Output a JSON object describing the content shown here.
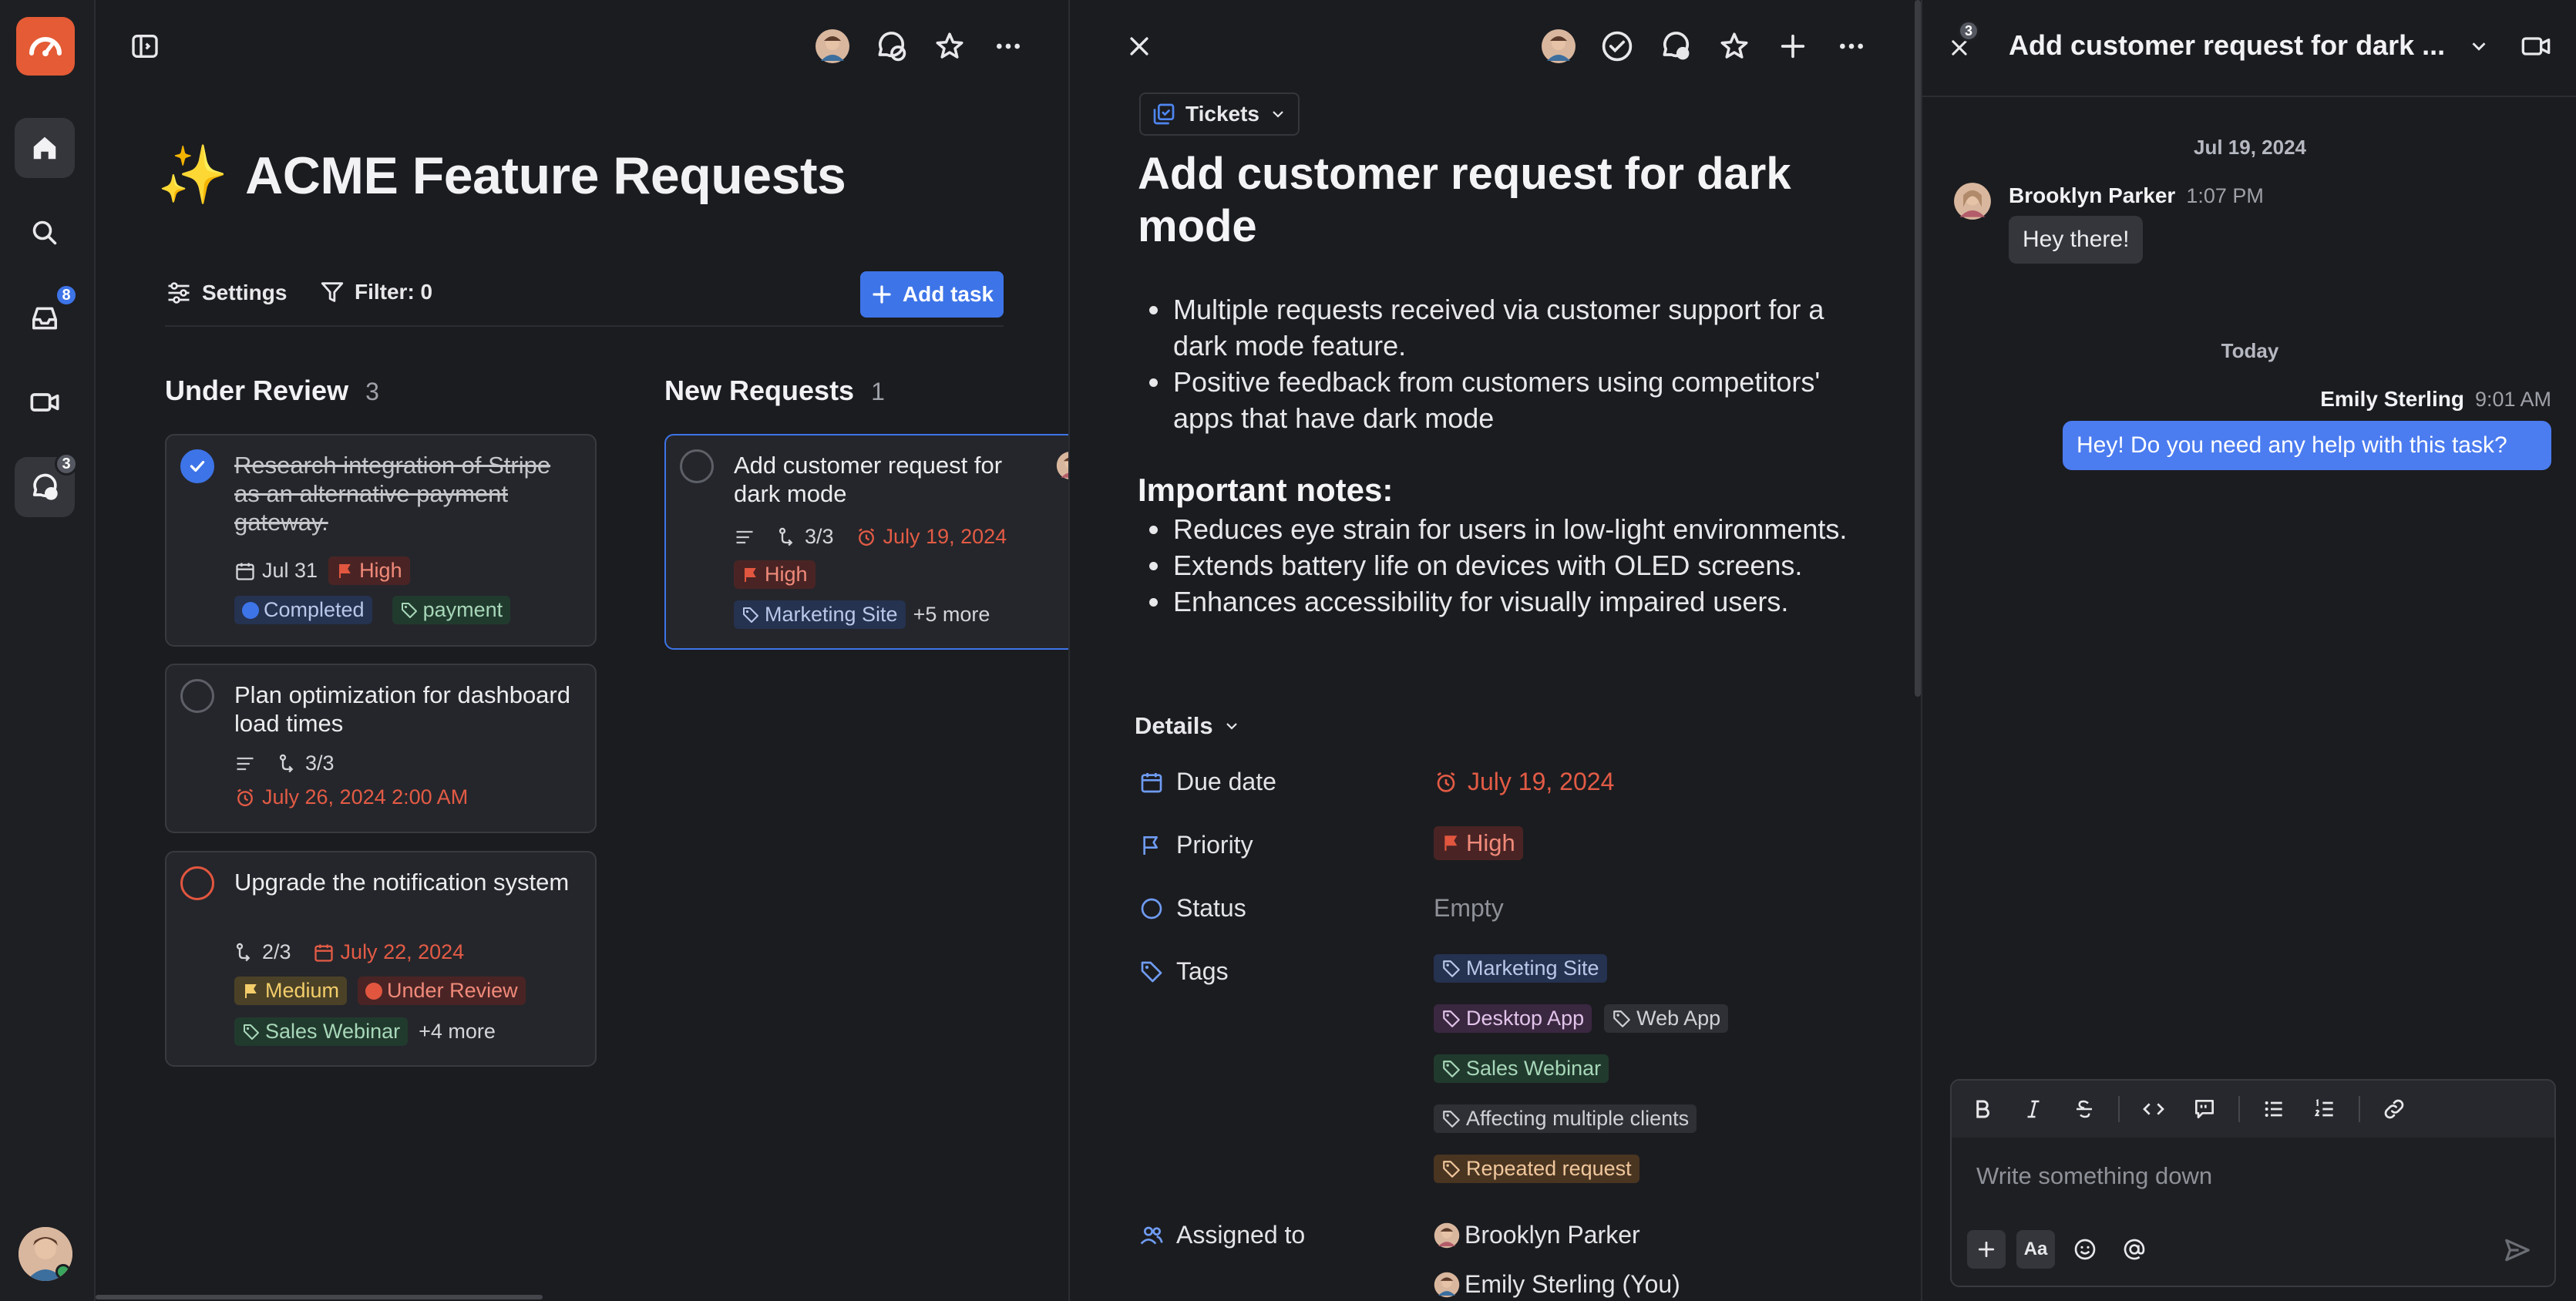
{
  "colors": {
    "accent": "#3d74e8",
    "danger": "#e35b45",
    "logo": "#e45b35"
  },
  "rail": {
    "inbox_badge": "8",
    "chat_badge": "3"
  },
  "board": {
    "title_emoji": "✨",
    "title": "ACME Feature Requests",
    "settings_label": "Settings",
    "filter_label": "Filter: 0",
    "add_task_label": "Add task",
    "columns": [
      {
        "title": "Under Review",
        "count": "3",
        "cards": [
          {
            "title": "Research integration of Stripe as an alternative payment gateway.",
            "date": "Jul 31",
            "priority": "High",
            "status": "Completed",
            "tag": "payment"
          },
          {
            "title": "Plan optimization for dashboard load times",
            "subtasks": "3/3",
            "due": "July 26, 2024 2:00 AM"
          },
          {
            "title": "Upgrade the notification system",
            "subtasks": "2/3",
            "due": "July 22, 2024",
            "priority": "Medium",
            "status": "Under Review",
            "tag": "Sales Webinar",
            "more": "+4 more"
          }
        ]
      },
      {
        "title": "New Requests",
        "count": "1",
        "cards": [
          {
            "title": "Add customer request for dark mode",
            "subtasks": "3/3",
            "due": "July 19, 2024",
            "priority": "High",
            "tag": "Marketing Site",
            "more": "+5 more"
          }
        ]
      }
    ]
  },
  "detail": {
    "breadcrumb": "Tickets",
    "title": "Add customer request for dark mode",
    "bullets": [
      "Multiple requests received via customer support for a dark mode feature.",
      "Positive feedback from customers using competitors' apps that have dark mode"
    ],
    "notes_heading": "Important notes:",
    "notes": [
      "Reduces eye strain for users in low-light environments.",
      "Extends battery life on devices with OLED screens.",
      "Enhances accessibility for visually impaired users."
    ],
    "details_label": "Details",
    "props": {
      "due_label": "Due date",
      "due_value": "July 19, 2024",
      "priority_label": "Priority",
      "priority_value": "High",
      "status_label": "Status",
      "status_value": "Empty",
      "tags_label": "Tags",
      "tags": [
        "Marketing Site",
        "Desktop App",
        "Web App",
        "Sales Webinar",
        "Affecting multiple clients",
        "Repeated request"
      ],
      "assigned_label": "Assigned to",
      "assignees": [
        "Brooklyn Parker",
        "Emily Sterling (You)"
      ]
    }
  },
  "chat": {
    "badge": "3",
    "title": "Add customer request for dark ...",
    "date1": "Jul 19, 2024",
    "msg1_author": "Brooklyn Parker",
    "msg1_time": "1:07 PM",
    "msg1_text": "Hey there!",
    "date2": "Today",
    "msg2_author": "Emily Sterling",
    "msg2_time": "9:01 AM",
    "msg2_text": "Hey! Do you need any help with this task?",
    "composer_placeholder": "Write something down",
    "font_btn": "Aa"
  }
}
